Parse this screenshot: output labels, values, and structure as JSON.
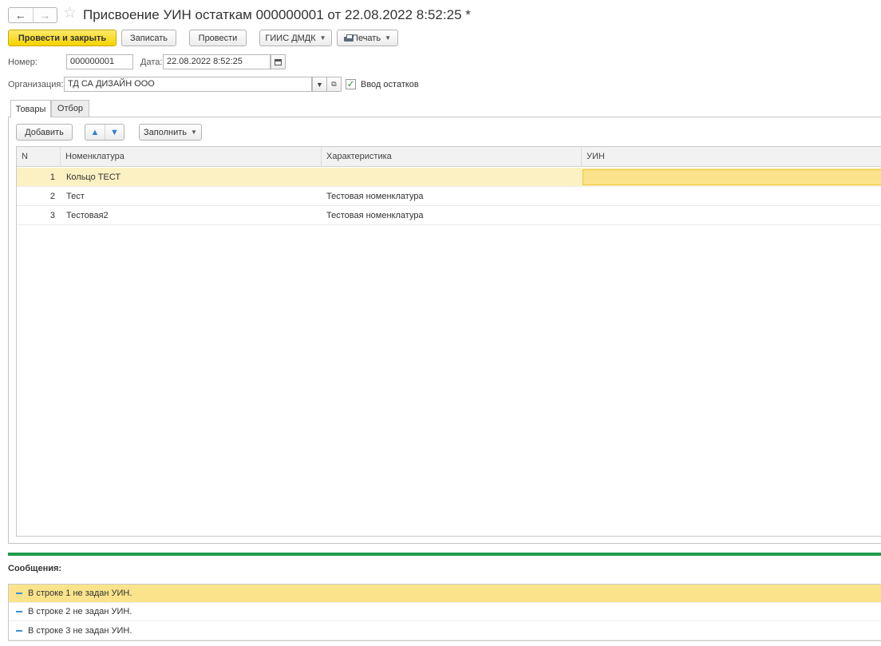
{
  "window": {
    "title": "Присвоение УИН остаткам 000000001 от 22.08.2022 8:52:25 *",
    "nav_back": "←",
    "nav_forward": "→",
    "star": "☆"
  },
  "toolbar": {
    "post_and_close": "Провести и закрыть",
    "save": "Записать",
    "post": "Провести",
    "giis": "ГИИС ДМДК",
    "print": "Печать"
  },
  "header": {
    "number_label": "Номер:",
    "number_value": "000000001",
    "date_label": "Дата:",
    "date_value": "22.08.2022  8:52:25",
    "org_label": "Организация:",
    "org_value": "ТД СА ДИЗАЙН ООО",
    "balances_label": "Ввод остатков",
    "balances_checked": true
  },
  "tabs": [
    {
      "label": "Товары",
      "active": true
    },
    {
      "label": "Отбор",
      "active": false
    }
  ],
  "table_toolbar": {
    "add": "Добавить",
    "fill": "Заполнить"
  },
  "table": {
    "columns": [
      "N",
      "Номенклатура",
      "Характеристика",
      "УИН"
    ],
    "rows": [
      {
        "n": "1",
        "nomenclature": "Кольцо ТЕСТ",
        "characteristic": "",
        "uin": ""
      },
      {
        "n": "2",
        "nomenclature": "Тест",
        "characteristic": "Тестовая номенклатура",
        "uin": ""
      },
      {
        "n": "3",
        "nomenclature": "Тестовая2",
        "characteristic": "Тестовая номенклатура",
        "uin": ""
      }
    ]
  },
  "messages": {
    "title": "Сообщения:",
    "items": [
      "В строке 1 не задан УИН.",
      "В строке 2 не задан УИН.",
      "В строке 3 не задан УИН."
    ]
  },
  "colors": {
    "primary_button": "#f7d300",
    "selected_row": "#fcf1c3",
    "active_cell": "#fbe38b",
    "divider": "#1f9a4b",
    "arrow": "#2f7fd0",
    "checkmark": "#2e9a3a"
  },
  "icons": [
    "back-arrow-icon",
    "forward-arrow-icon",
    "favorite-star-icon",
    "dropdown-caret-icon",
    "printer-icon",
    "calendar-icon",
    "open-icon",
    "checkmark-icon",
    "move-up-icon",
    "move-down-icon",
    "message-dash-icon"
  ]
}
